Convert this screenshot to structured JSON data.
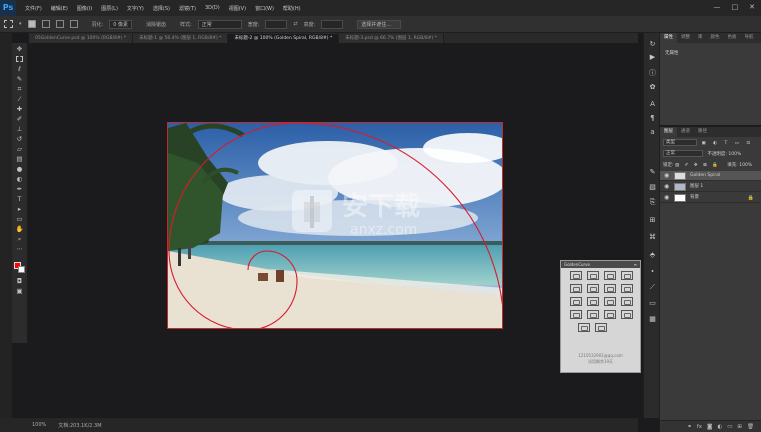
{
  "app": {
    "logo": "Ps",
    "window_controls": [
      "—",
      "□",
      "✕"
    ]
  },
  "menu": [
    "文件(F)",
    "编辑(E)",
    "图像(I)",
    "图层(L)",
    "文字(Y)",
    "选择(S)",
    "滤镜(T)",
    "3D(D)",
    "视图(V)",
    "窗口(W)",
    "帮助(H)"
  ],
  "options": {
    "feather_label": "羽化:",
    "feather_value": "0 像素",
    "antialias": "消除锯齿",
    "style_label": "样式:",
    "style_value": "正常",
    "width_label": "宽度:",
    "height_label": "高度:",
    "select_mask": "选择并遮住..."
  },
  "tabs": [
    {
      "label": "05GoldenCurve.psd @ 100% (RGB/8#) *",
      "active": false
    },
    {
      "label": "未标题-1 @ 56.4% (图层 1, RGB/8#) *",
      "active": false
    },
    {
      "label": "未标题-2 @ 100% (Golden Spiral, RGB/8#) *",
      "active": true
    },
    {
      "label": "未标题-3.psd @ 66.7% (图层 1, RGB/8#) *",
      "active": false
    }
  ],
  "status": {
    "zoom": "100%",
    "doc": "文档:203.1K/2.3M"
  },
  "golden_curve": {
    "title": "GoldenCurve",
    "contact": "1210532901@qq.com",
    "trial": "试用剩余19天"
  },
  "properties": {
    "tabs": [
      "属性",
      "调整",
      "库",
      "颜色",
      "色板",
      "导航"
    ],
    "text": "无属性"
  },
  "layers": {
    "tabs": [
      "图层",
      "通道",
      "路径"
    ],
    "kind": "类型",
    "blend": "正常",
    "opacity_label": "不透明度:",
    "opacity": "100%",
    "lock_label": "锁定:",
    "fill_label": "填充:",
    "fill": "100%",
    "items": [
      {
        "name": "Golden Spiral",
        "selected": true
      },
      {
        "name": "图层 1",
        "selected": false
      },
      {
        "name": "背景",
        "selected": false
      }
    ]
  },
  "watermark": {
    "main": "安下载",
    "sub": "anxz.com"
  },
  "colors": {
    "foreground": "#ff0000",
    "background": "#ffffff",
    "spiral": "#d81b2b"
  }
}
